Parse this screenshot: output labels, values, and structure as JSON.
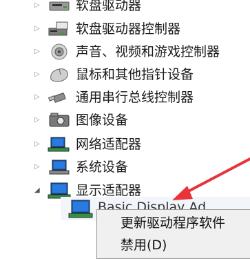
{
  "device_tree": {
    "categories": [
      {
        "label": "软盘驱动器",
        "icon": "floppy-drive-icon",
        "expanded": false
      },
      {
        "label": "软盘驱动器控制器",
        "icon": "floppy-controller-icon",
        "expanded": false
      },
      {
        "label": "声音、视频和游戏控制器",
        "icon": "speaker-icon",
        "expanded": false
      },
      {
        "label": "鼠标和其他指针设备",
        "icon": "mouse-icon",
        "expanded": false
      },
      {
        "label": "通用串行总线控制器",
        "icon": "usb-icon",
        "expanded": false
      },
      {
        "label": "图像设备",
        "icon": "camera-icon",
        "expanded": false
      },
      {
        "label": "网络适配器",
        "icon": "network-adapter-icon",
        "expanded": false
      },
      {
        "label": "系统设备",
        "icon": "system-devices-icon",
        "expanded": false
      },
      {
        "label": "显示适配器",
        "icon": "display-adapter-icon",
        "expanded": true
      }
    ],
    "child_device": {
      "label": "Basic Display Ad",
      "icon": "monitor-icon"
    }
  },
  "context_menu": {
    "items": [
      {
        "label": "更新驱动程序软件"
      },
      {
        "label": "禁用(D)"
      }
    ]
  },
  "annotation": {
    "color": "#e8333a"
  }
}
